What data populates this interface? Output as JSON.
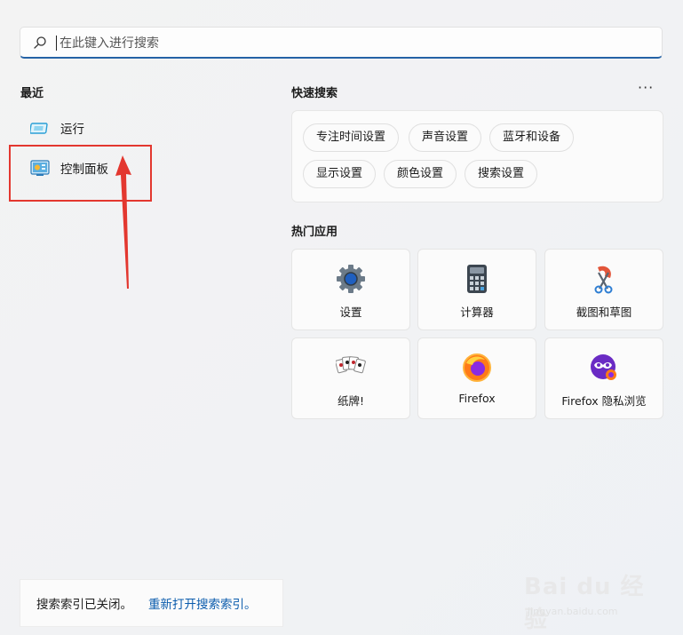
{
  "search": {
    "placeholder": "在此键入进行搜索"
  },
  "recent": {
    "title": "最近",
    "items": [
      {
        "label": "运行"
      },
      {
        "label": "控制面板"
      }
    ]
  },
  "quick_search": {
    "title": "快速搜索",
    "more": "···",
    "items": [
      {
        "label": "专注时间设置"
      },
      {
        "label": "声音设置"
      },
      {
        "label": "蓝牙和设备"
      },
      {
        "label": "显示设置"
      },
      {
        "label": "颜色设置"
      },
      {
        "label": "搜索设置"
      }
    ]
  },
  "top_apps": {
    "title": "热门应用",
    "items": [
      {
        "label": "设置",
        "icon": "gear-icon"
      },
      {
        "label": "计算器",
        "icon": "calculator-icon"
      },
      {
        "label": "截图和草图",
        "icon": "snipping-tool-icon"
      },
      {
        "label": "纸牌!",
        "icon": "solitaire-icon"
      },
      {
        "label": "Firefox",
        "icon": "firefox-icon"
      },
      {
        "label": "Firefox 隐私浏览",
        "icon": "firefox-private-icon"
      }
    ]
  },
  "status": {
    "text": "搜索索引已关闭。",
    "link": "重新打开搜索索引。"
  },
  "watermark": {
    "logo": "Bai du 经验",
    "url": "jingyan.baidu.com"
  },
  "colors": {
    "accent": "#2563a6",
    "highlight": "#e3372f",
    "link": "#0b5cad"
  }
}
